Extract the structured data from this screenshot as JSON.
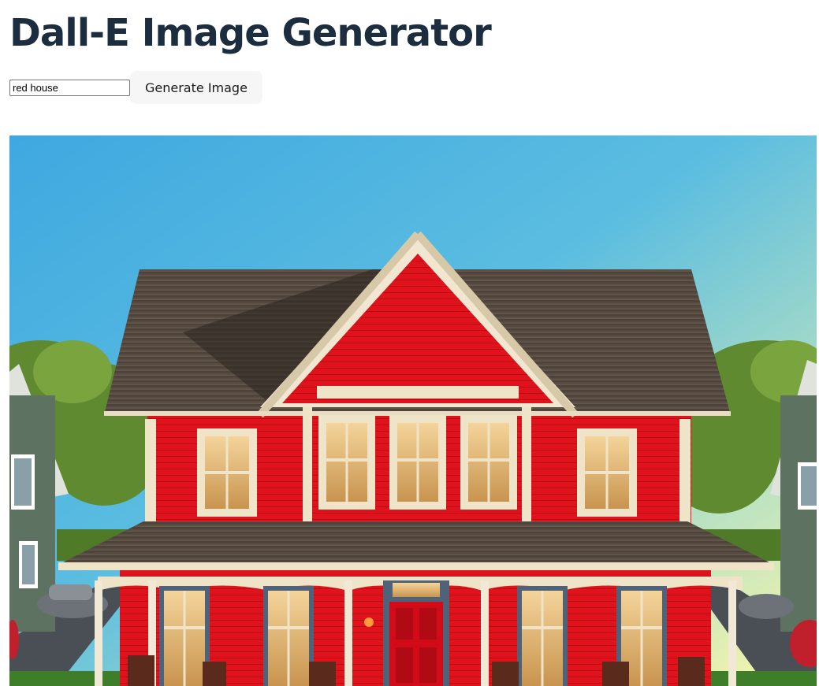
{
  "page": {
    "title": "Dall-E Image Generator"
  },
  "form": {
    "prompt_value": "red house",
    "generate_label": "Generate Image"
  },
  "result": {
    "image_subject": "red-house-illustration"
  }
}
